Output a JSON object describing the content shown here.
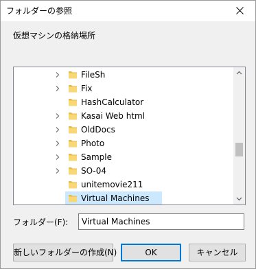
{
  "window": {
    "title": "フォルダーの参照",
    "close_icon": "close-icon"
  },
  "prompt": "仮想マシンの格納場所",
  "tree": {
    "items": [
      {
        "label": "FileSh",
        "expandable": true,
        "selected": false
      },
      {
        "label": "Fix",
        "expandable": true,
        "selected": false
      },
      {
        "label": "HashCalculator",
        "expandable": false,
        "selected": false
      },
      {
        "label": "Kasai Web html",
        "expandable": true,
        "selected": false
      },
      {
        "label": "OldDocs",
        "expandable": true,
        "selected": false
      },
      {
        "label": "Photo",
        "expandable": true,
        "selected": false
      },
      {
        "label": "Sample",
        "expandable": true,
        "selected": false
      },
      {
        "label": "SO-04",
        "expandable": true,
        "selected": false
      },
      {
        "label": "unitemovie211",
        "expandable": false,
        "selected": false
      },
      {
        "label": "Virtual Machines",
        "expandable": false,
        "selected": true
      }
    ]
  },
  "folder_field": {
    "label": "フォルダー(F):",
    "value": "Virtual Machines"
  },
  "buttons": {
    "new_folder": "新しいフォルダーの作成(N)",
    "ok": "OK",
    "cancel": "キャンセル"
  },
  "colors": {
    "folder": "#f8d775",
    "selection": "#cce8ff",
    "accent": "#0078d7"
  }
}
